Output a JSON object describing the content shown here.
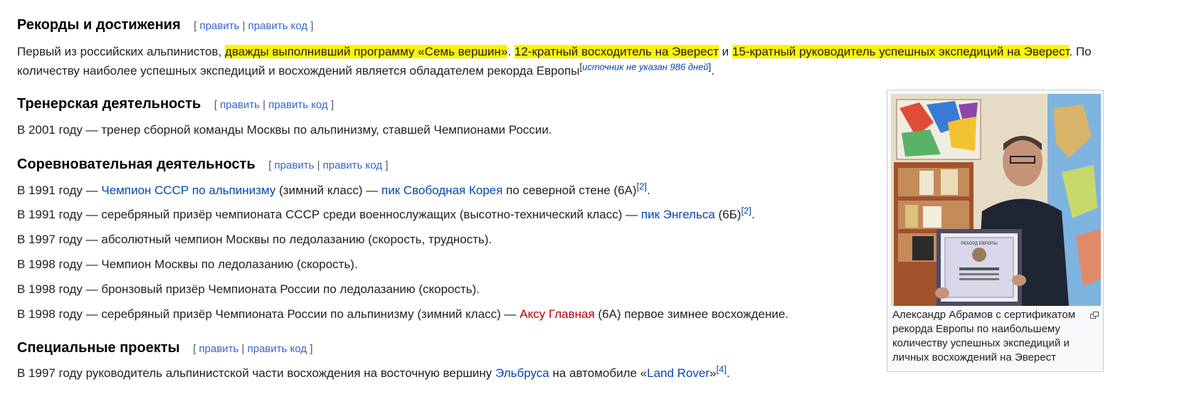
{
  "edit": {
    "open": "[",
    "edit": "править",
    "sep": "|",
    "edit_source": "править код",
    "close": "]"
  },
  "records": {
    "heading": "Рекорды и достижения",
    "t1": "Первый из российских альпинистов,",
    "hl1": "дважды выполнивший программу «Семь вершин»",
    "t2": ".",
    "hl2": "12-кратный восходитель на Эверест",
    "t3": "и",
    "hl3": "15-кратный руководитель успешных экспедиций на Эверест",
    "t4": ". По количеству наиболее успешных экспедиций и восхождений является обладателем рекорда Европы",
    "cite": "источник не указан 986 дней",
    "t5": "."
  },
  "trainer": {
    "heading": "Тренерская деятельность",
    "text": "В 2001 году — тренер сборной команды Москвы по альпинизму, ставшей Чемпионами России."
  },
  "competition": {
    "heading": "Соревновательная деятельность",
    "r1": {
      "a": "В 1991 году —",
      "link1": "Чемпион СССР по альпинизму",
      "b": "(зимний класс) —",
      "link2": "пик Свободная Корея",
      "c": "по северной стене (6А)",
      "ref": "[2]",
      "d": "."
    },
    "r2": {
      "a": "В 1991 году — серебряный призёр чемпионата СССР среди военнослужащих (высотно-технический класс) —",
      "link": "пик Энгельса",
      "b": "(6Б)",
      "ref": "[2]",
      "c": "."
    },
    "r3": "В 1997 году — абсолютный чемпион Москвы по ледолазанию (скорость, трудность).",
    "r4": "В 1998 году — Чемпион Москвы по ледолазанию (скорость).",
    "r5": "В 1998 году — бронзовый призёр Чемпионата России по ледолазанию (скорость).",
    "r6": {
      "a": "В 1998 году — серебряный призёр Чемпионата России по альпинизму (зимний класс) —",
      "link": "Аксу Главная",
      "b": "(6А) первое зимнее восхождение."
    }
  },
  "special": {
    "heading": "Специальные проекты",
    "a": "В 1997 году руководитель альпинистской части восхождения на восточную вершину",
    "link1": "Эльбруса",
    "b": "на автомобиле «",
    "link2": "Land Rover",
    "c": "»",
    "ref": "[4]",
    "d": "."
  },
  "figure": {
    "caption": "Александр Абрамов с сертификатом рекорда Европы по наибольшему количеству успешных экспедиций и личных восхождений на Эверест",
    "certificate_title": "РЕКОРД ЕВРОПЫ"
  },
  "colors": {
    "link": "#0645ad",
    "redlink": "#ba0000",
    "highlight": "#fff200"
  }
}
